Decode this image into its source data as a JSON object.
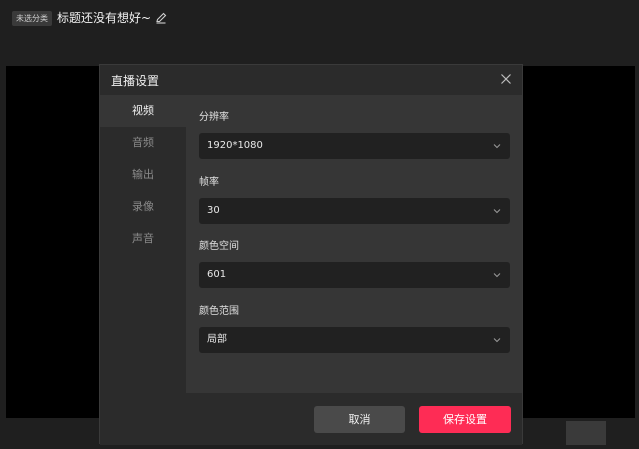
{
  "topbar": {
    "tag": "未选分类",
    "title": "标题还没有想好~",
    "edit_icon": "pencil-icon"
  },
  "dialog": {
    "title": "直播设置",
    "close_icon": "close-icon",
    "nav": [
      {
        "label": "视频",
        "active": true
      },
      {
        "label": "音频",
        "active": false
      },
      {
        "label": "输出",
        "active": false
      },
      {
        "label": "录像",
        "active": false
      },
      {
        "label": "声音",
        "active": false
      }
    ],
    "fields": [
      {
        "label": "分辨率",
        "value": "1920*1080"
      },
      {
        "label": "帧率",
        "value": "30"
      },
      {
        "label": "颜色空间",
        "value": "601"
      },
      {
        "label": "颜色范围",
        "value": "局部"
      }
    ],
    "cancel_label": "取消",
    "save_label": "保存设置"
  },
  "colors": {
    "accent": "#fe2c55",
    "dialog_bg": "#2b2b2b",
    "content_bg": "#363636",
    "select_bg": "#212121"
  }
}
